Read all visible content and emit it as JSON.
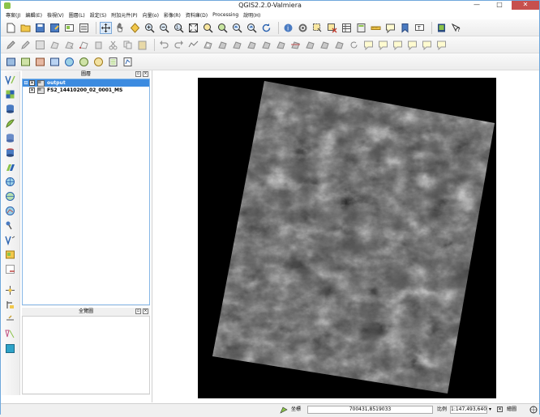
{
  "window": {
    "title": "QGIS2.2.0-Valmiera",
    "minimize": "—",
    "maximize": "□",
    "close": "✕"
  },
  "menu": [
    "專案(J)",
    "編輯(E)",
    "檢視(V)",
    "圖層(L)",
    "設定(S)",
    "附加元件(P)",
    "向量(o)",
    "影像(R)",
    "資料庫(D)",
    "Processing",
    "說明(H)"
  ],
  "panels": {
    "layers": {
      "title": "圖層",
      "items": [
        {
          "label": "output",
          "checked": true,
          "selected": true
        },
        {
          "label": "FS2_14410200_02_0001_MS",
          "checked": true,
          "selected": false
        }
      ]
    },
    "overview": {
      "title": "全覽圖"
    }
  },
  "statusbar": {
    "coord_label": "坐標",
    "coord_value": "700431,8519033",
    "scale_label": "比例",
    "scale_value": "1:147,493,640",
    "render_label": "繪圖"
  },
  "colors": {
    "selection": "#3c8be0",
    "panel_border": "#86b7e6",
    "close_button": "#c7504d"
  }
}
